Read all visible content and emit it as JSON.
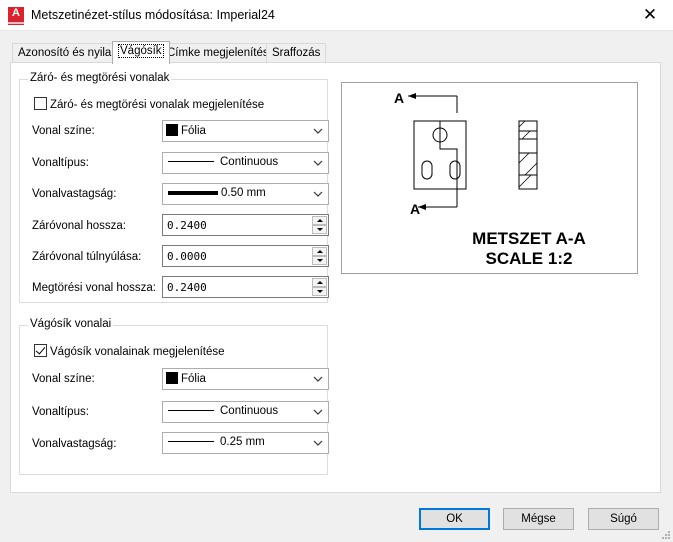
{
  "window": {
    "title": "Metszetinézet-stílus módosítása: Imperial24",
    "app_icon_letter": "A",
    "close_glyph": "✕"
  },
  "tabs": [
    {
      "label": "Azonosító és nyilak",
      "active": false
    },
    {
      "label": "Vágósík",
      "active": true
    },
    {
      "label": "Címke megjelenítése",
      "active": false
    },
    {
      "label": "Sraffozás",
      "active": false
    }
  ],
  "group1": {
    "title": "Záró- és megtörési vonalak",
    "show_checkbox": {
      "label": "Záró- és megtörési vonalak megjelenítése",
      "checked": false
    },
    "line_color": {
      "label": "Vonal színe:",
      "value": "Fólia",
      "swatch": "#000000"
    },
    "line_type": {
      "label": "Vonaltípus:",
      "value": "Continuous"
    },
    "line_weight": {
      "label": "Vonalvastagság:",
      "value": "0.50 mm"
    },
    "end_line_length": {
      "label": "Záróvonal hossza:",
      "value": "0.2400"
    },
    "end_line_overshoot": {
      "label": "Záróvonal túlnyúlása:",
      "value": "0.0000"
    },
    "jog_line_length": {
      "label": "Megtörési vonal hossza:",
      "value": "0.2400"
    }
  },
  "group2": {
    "title": "Vágósík vonalai",
    "show_checkbox": {
      "label": "Vágósík vonalainak megjelenítése",
      "checked": true
    },
    "line_color": {
      "label": "Vonal színe:",
      "value": "Fólia",
      "swatch": "#000000"
    },
    "line_type": {
      "label": "Vonaltípus:",
      "value": "Continuous"
    },
    "line_weight": {
      "label": "Vonalvastagság:",
      "value": "0.25 mm"
    }
  },
  "preview": {
    "marker_top": "A",
    "marker_bottom": "A",
    "title_line1": "METSZET A-A",
    "title_line2": "SCALE 1:2"
  },
  "buttons": {
    "ok": "OK",
    "cancel": "Mégse",
    "help": "Súgó"
  },
  "icons": {
    "dropdown": "chevron-down-icon",
    "spin_up": "spin-up-icon",
    "spin_down": "spin-down-icon",
    "close": "close-icon",
    "app": "autocad-app-icon",
    "resize": "resize-grip-icon"
  }
}
